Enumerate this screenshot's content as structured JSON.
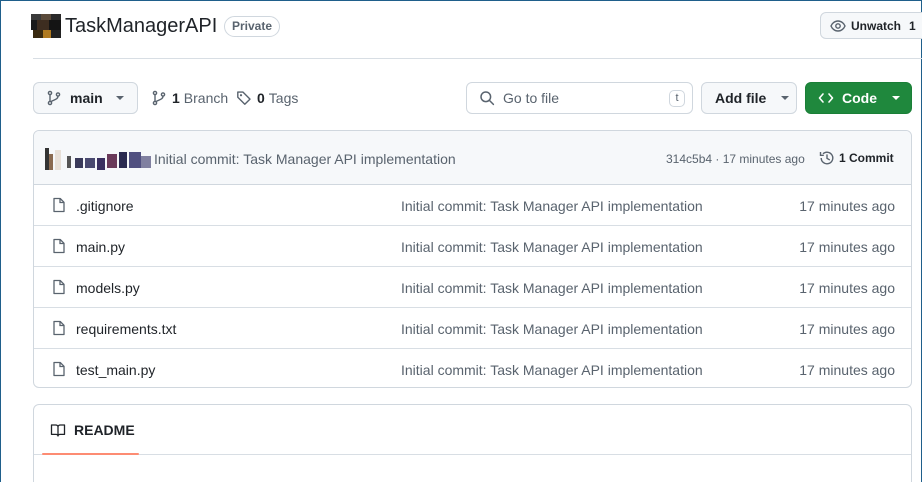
{
  "repo": {
    "name": "TaskManagerAPI",
    "visibility": "Private"
  },
  "watch": {
    "label": "Unwatch",
    "count": "1"
  },
  "toolbar": {
    "branch": "main",
    "branches_count": "1",
    "branches_label": "Branch",
    "tags_count": "0",
    "tags_label": "Tags",
    "search_placeholder": "Go to file",
    "search_shortcut": "t",
    "add_file_label": "Add file",
    "code_label": "Code"
  },
  "latest_commit": {
    "message": "Initial commit: Task Manager API implementation",
    "hash_time": "314c5b4 · 17 minutes ago",
    "commits_label": "1 Commit"
  },
  "files": [
    {
      "name": ".gitignore",
      "commit": "Initial commit: Task Manager API implementation",
      "age": "17 minutes ago"
    },
    {
      "name": "main.py",
      "commit": "Initial commit: Task Manager API implementation",
      "age": "17 minutes ago"
    },
    {
      "name": "models.py",
      "commit": "Initial commit: Task Manager API implementation",
      "age": "17 minutes ago"
    },
    {
      "name": "requirements.txt",
      "commit": "Initial commit: Task Manager API implementation",
      "age": "17 minutes ago"
    },
    {
      "name": "test_main.py",
      "commit": "Initial commit: Task Manager API implementation",
      "age": "17 minutes ago"
    }
  ],
  "readme": {
    "tab_label": "README"
  },
  "colors": {
    "code_button": "#1f883d",
    "readme_underline": "#fd8c73",
    "border": "#d0d7de"
  },
  "icons": [
    "eye-icon",
    "git-branch-icon",
    "tag-icon",
    "search-icon",
    "code-icon",
    "chevron-down-icon",
    "history-icon",
    "file-icon",
    "book-icon"
  ]
}
